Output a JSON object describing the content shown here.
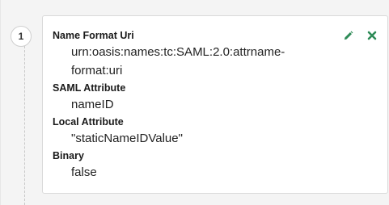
{
  "step": {
    "number": "1"
  },
  "card": {
    "fields": [
      {
        "label": "Name Format Uri",
        "value": "urn:oasis:names:tc:SAML:2.0:attrname-format:uri",
        "value_lines": [
          "urn:oasis:names:tc:SAML:2.0:attrname-",
          "format:uri"
        ]
      },
      {
        "label": "SAML Attribute",
        "value": "nameID"
      },
      {
        "label": "Local Attribute",
        "value": "\"staticNameIDValue\""
      },
      {
        "label": "Binary",
        "value": "false"
      }
    ],
    "actions": {
      "edit_icon": "pencil-icon",
      "delete_icon": "close-icon"
    }
  },
  "colors": {
    "action_green": "#2e8b57"
  }
}
